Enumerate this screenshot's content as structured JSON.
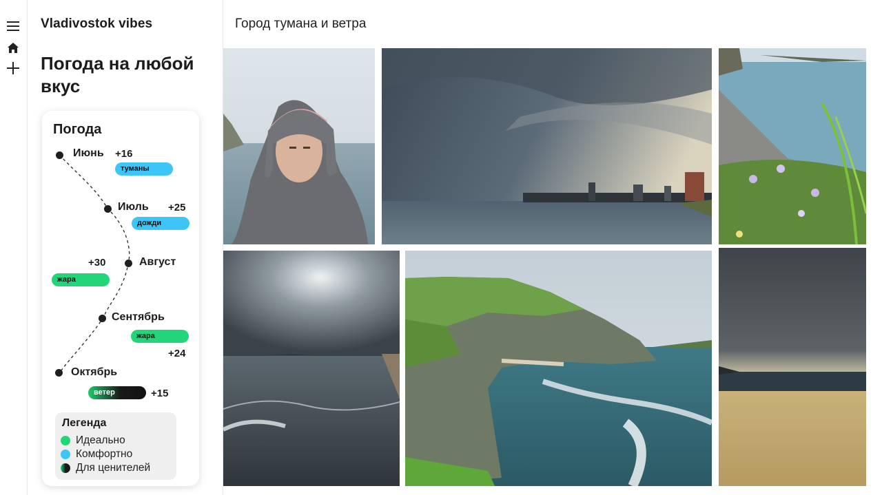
{
  "nav": {
    "icons": [
      "menu-icon",
      "home-icon",
      "plus-icon"
    ]
  },
  "sidebar": {
    "brand": "Vladivostok vibes",
    "headline": "Погода на любой вкус"
  },
  "weather": {
    "title": "Погода",
    "months": [
      {
        "name": "Июнь",
        "temp": "+16",
        "tag": "туманы",
        "tag_color": "#3ec5f7"
      },
      {
        "name": "Июль",
        "temp": "+25",
        "tag": "дожди",
        "tag_color": "#3ec5f7"
      },
      {
        "name": "Август",
        "temp": "+30",
        "tag": "жара",
        "tag_color": "#21d67a"
      },
      {
        "name": "Сентябрь",
        "temp": "+24",
        "tag": "жара",
        "tag_color": "#21d67a"
      },
      {
        "name": "Октябрь",
        "temp": "+15",
        "tag": "ветер",
        "tag_color": "#1a1a1a"
      }
    ],
    "legend": {
      "title": "Легенда",
      "items": [
        {
          "label": "Идеально",
          "color": "#21d67a"
        },
        {
          "label": "Комфортно",
          "color": "#3ec5f7"
        },
        {
          "label": "Для ценителей",
          "color": "#1a1a1a"
        }
      ]
    }
  },
  "main": {
    "title": "Город тумана и ветра",
    "photos": [
      "photo-selfie-hood",
      "photo-stormy-bay-city",
      "photo-rocky-shore-flowers",
      "photo-sunbeams-waves",
      "photo-green-cliff-sea",
      "photo-sandy-beach-clouds"
    ]
  }
}
